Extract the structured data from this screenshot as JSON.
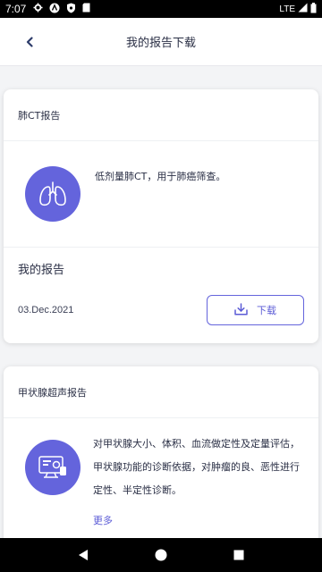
{
  "status_bar": {
    "time": "7:07",
    "network": "LTE",
    "icons": [
      "gear-icon",
      "vpn-icon",
      "shield-icon",
      "sd-card-icon",
      "signal-icon",
      "battery-icon"
    ]
  },
  "header": {
    "title": "我的报告下载",
    "back_icon": "chevron-left-icon"
  },
  "cards": [
    {
      "title": "肺CT报告",
      "icon": "lungs-icon",
      "description": "低剂量肺CT，用于肺癌筛查。",
      "report_label": "我的报告",
      "date": "03.Dec.2021",
      "download_label": "下载"
    },
    {
      "title": "甲状腺超声报告",
      "icon": "ultrasound-screen-icon",
      "description": "对甲状腺大小、体积、血流做定性及定量评估，甲状腺功能的诊断依据，对肿瘤的良、恶性进行定性、半定性诊断。",
      "more_label": "更多"
    }
  ],
  "colors": {
    "accent": "#6464dc",
    "background": "#f3f4f6",
    "text": "#2a2f45"
  },
  "nav_bar": {
    "icons": [
      "back-triangle-icon",
      "home-circle-icon",
      "recents-square-icon"
    ]
  }
}
